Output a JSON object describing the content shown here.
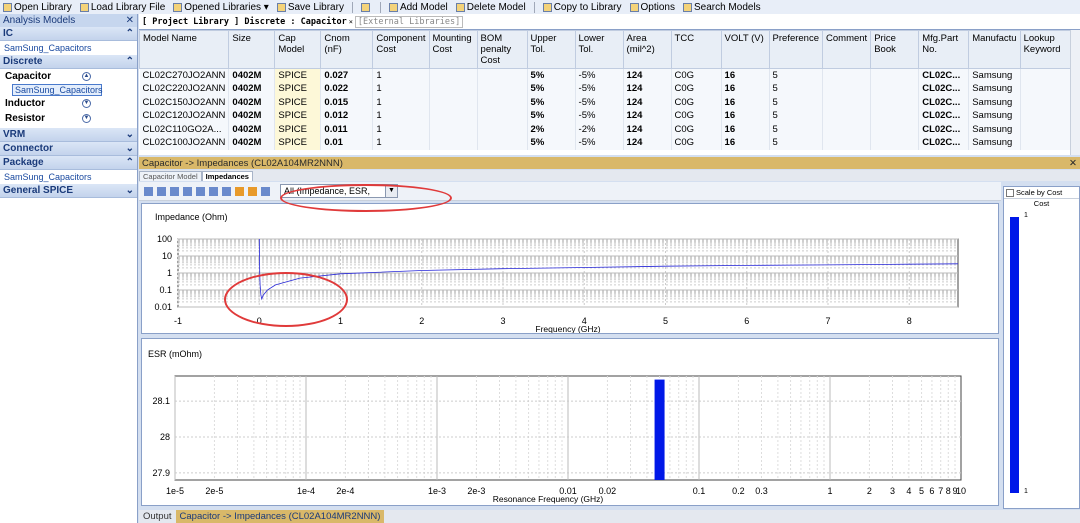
{
  "toolbar": {
    "items": [
      {
        "label": "Open Library"
      },
      {
        "label": "Load Library File"
      },
      {
        "label": "Opened Libraries ▾"
      },
      {
        "label": "Save Library"
      },
      {
        "label": ""
      },
      {
        "label": "Add Model"
      },
      {
        "label": "Delete Model"
      },
      {
        "label": "Copy to Library"
      },
      {
        "label": "Options"
      },
      {
        "label": "Search Models"
      }
    ]
  },
  "left_panel": {
    "title": "Analysis Models",
    "ic": "IC",
    "ic_link": "SamSung_Capacitors",
    "discrete": "Discrete",
    "capacitor": "Capacitor",
    "cap_link": "SamSung_Capacitors",
    "inductor": "Inductor",
    "resistor": "Resistor",
    "vrm": "VRM",
    "connector": "Connector",
    "package": "Package",
    "package_link": "SamSung_Capacitors",
    "spice": "General SPICE"
  },
  "tabs": {
    "project": "[ Project Library ] Discrete : Capacitor",
    "external": "[External Libraries]"
  },
  "table": {
    "columns": [
      "Model Name",
      "Size",
      "Cap Model",
      "Cnom (nF)",
      "Component Cost",
      "Mounting Cost",
      "BOM penalty Cost",
      "Upper Tol.",
      "Lower Tol.",
      "Area (mil^2)",
      "TCC",
      "VOLT (V)",
      "Preference",
      "Comment",
      "Price Book",
      "Mfg.Part No.",
      "Manufactu",
      "Lookup Keyword"
    ],
    "rows": [
      [
        "CL02C270JO2ANN",
        "0402M",
        "SPICE",
        "0.027",
        "1",
        "",
        "",
        "5%",
        "-5%",
        "124",
        "C0G",
        "16",
        "5",
        "",
        "",
        "CL02C...",
        "Samsung",
        ""
      ],
      [
        "CL02C220JO2ANN",
        "0402M",
        "SPICE",
        "0.022",
        "1",
        "",
        "",
        "5%",
        "-5%",
        "124",
        "C0G",
        "16",
        "5",
        "",
        "",
        "CL02C...",
        "Samsung",
        ""
      ],
      [
        "CL02C150JO2ANN",
        "0402M",
        "SPICE",
        "0.015",
        "1",
        "",
        "",
        "5%",
        "-5%",
        "124",
        "C0G",
        "16",
        "5",
        "",
        "",
        "CL02C...",
        "Samsung",
        ""
      ],
      [
        "CL02C120JO2ANN",
        "0402M",
        "SPICE",
        "0.012",
        "1",
        "",
        "",
        "5%",
        "-5%",
        "124",
        "C0G",
        "16",
        "5",
        "",
        "",
        "CL02C...",
        "Samsung",
        ""
      ],
      [
        "CL02C110GO2A...",
        "0402M",
        "SPICE",
        "0.011",
        "1",
        "",
        "",
        "2%",
        "-2%",
        "124",
        "C0G",
        "16",
        "5",
        "",
        "",
        "CL02C...",
        "Samsung",
        ""
      ],
      [
        "CL02C100JO2ANN",
        "0402M",
        "SPICE",
        "0.01",
        "1",
        "",
        "",
        "5%",
        "-5%",
        "124",
        "C0G",
        "16",
        "5",
        "",
        "",
        "CL02C...",
        "Samsung",
        ""
      ]
    ]
  },
  "panel": {
    "title": "Capacitor -> Impedances (CL02A104MR2NNN)",
    "tab_model": "Capacitor Model",
    "tab_imp": "Impedances",
    "combo": "All (Impedance, ESR,"
  },
  "chart_data": [
    {
      "type": "line",
      "title": "Impedance (Ohm)",
      "xlabel": "Frequency (GHz)",
      "xlim": [
        -1,
        8.6
      ],
      "y_scale": "log",
      "ylim": [
        0.01,
        100
      ],
      "x_ticks": [
        "-1",
        "0",
        "1",
        "2",
        "3",
        "4",
        "5",
        "6",
        "7",
        "8"
      ],
      "y_ticks": [
        "100",
        "10",
        "1",
        "0.1",
        "0.01"
      ],
      "series": [
        {
          "x": [
            0,
            0.005,
            0.01,
            0.02,
            0.03,
            0.05,
            0.1,
            0.2,
            0.5,
            1,
            2,
            3,
            4,
            5,
            6,
            7,
            8,
            8.6
          ],
          "y": [
            100,
            1,
            0.2,
            0.05,
            0.03,
            0.05,
            0.1,
            0.2,
            0.5,
            0.9,
            1.4,
            1.8,
            2.1,
            2.5,
            2.8,
            3,
            3.3,
            3.5
          ]
        }
      ],
      "grid": true
    },
    {
      "type": "bar",
      "title": "ESR (mOhm)",
      "xlabel": "Resonance Frequency (GHz)",
      "x_scale": "log",
      "xlim": [
        1e-05,
        10
      ],
      "ylim": [
        27.88,
        28.17
      ],
      "x_ticks": [
        "1e-5",
        "2e-5",
        "1e-4",
        "2e-4",
        "1e-3",
        "2e-3",
        "0.01",
        "0.02",
        "0.1",
        "0.2",
        "0.3",
        "1",
        "2",
        "3",
        "4",
        "5",
        "6",
        "7",
        "8",
        "9",
        "10"
      ],
      "y_ticks": [
        "28.1",
        "28",
        "27.9"
      ],
      "series": [
        {
          "x": [
            0.05
          ],
          "y": [
            28.16
          ]
        }
      ],
      "grid": true
    }
  ],
  "sidebar": {
    "check": "Scale by Cost",
    "title": "Cost",
    "top": "1",
    "bottom": "1"
  },
  "output": {
    "tab1": "Output",
    "tab2": "Capacitor -> Impedances (CL02A104MR2NNN)"
  }
}
